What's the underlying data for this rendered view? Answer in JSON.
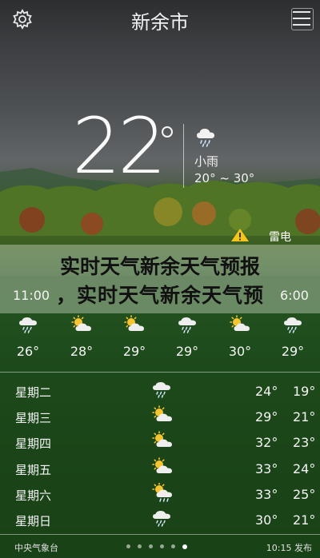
{
  "header": {
    "city": "新余市"
  },
  "current": {
    "temp": "22",
    "condition": "小雨",
    "range": "20° ~ 30°",
    "icon": "light-rain-icon"
  },
  "alert": {
    "label": "雷电",
    "icon": "warning-icon",
    "color": "#f5c518"
  },
  "banner": {
    "line1": "实时天气新余天气预报",
    "line2": "，实时天气新余天气预"
  },
  "hourly": {
    "times": [
      {
        "label": "11:00",
        "visible": true
      },
      {
        "label": "6:00",
        "visible": true
      }
    ],
    "items": [
      {
        "icon": "cloud-rain-icon",
        "temp": "26°"
      },
      {
        "icon": "partly-cloudy-sun-icon",
        "temp": "28°"
      },
      {
        "icon": "partly-cloudy-sun-icon",
        "temp": "29°"
      },
      {
        "icon": "cloud-rain-icon",
        "temp": "29°"
      },
      {
        "icon": "partly-cloudy-sun-icon",
        "temp": "30°"
      },
      {
        "icon": "cloud-rain-icon",
        "temp": "29°"
      }
    ]
  },
  "daily": [
    {
      "day": "星期二",
      "icon": "cloud-rain-icon",
      "high": "24°",
      "low": "19°"
    },
    {
      "day": "星期三",
      "icon": "partly-cloudy-sun-icon",
      "high": "29°",
      "low": "21°"
    },
    {
      "day": "星期四",
      "icon": "partly-cloudy-sun-icon",
      "high": "32°",
      "low": "23°"
    },
    {
      "day": "星期五",
      "icon": "partly-cloudy-sun-icon",
      "high": "33°",
      "low": "24°"
    },
    {
      "day": "星期六",
      "icon": "sun-cloud-rain-icon",
      "high": "33°",
      "low": "25°"
    },
    {
      "day": "星期日",
      "icon": "cloud-rain-icon",
      "high": "30°",
      "low": "21°"
    }
  ],
  "footer": {
    "source": "中央气象台",
    "updated": "10:15 发布",
    "pages": 6,
    "active_page": 5
  }
}
